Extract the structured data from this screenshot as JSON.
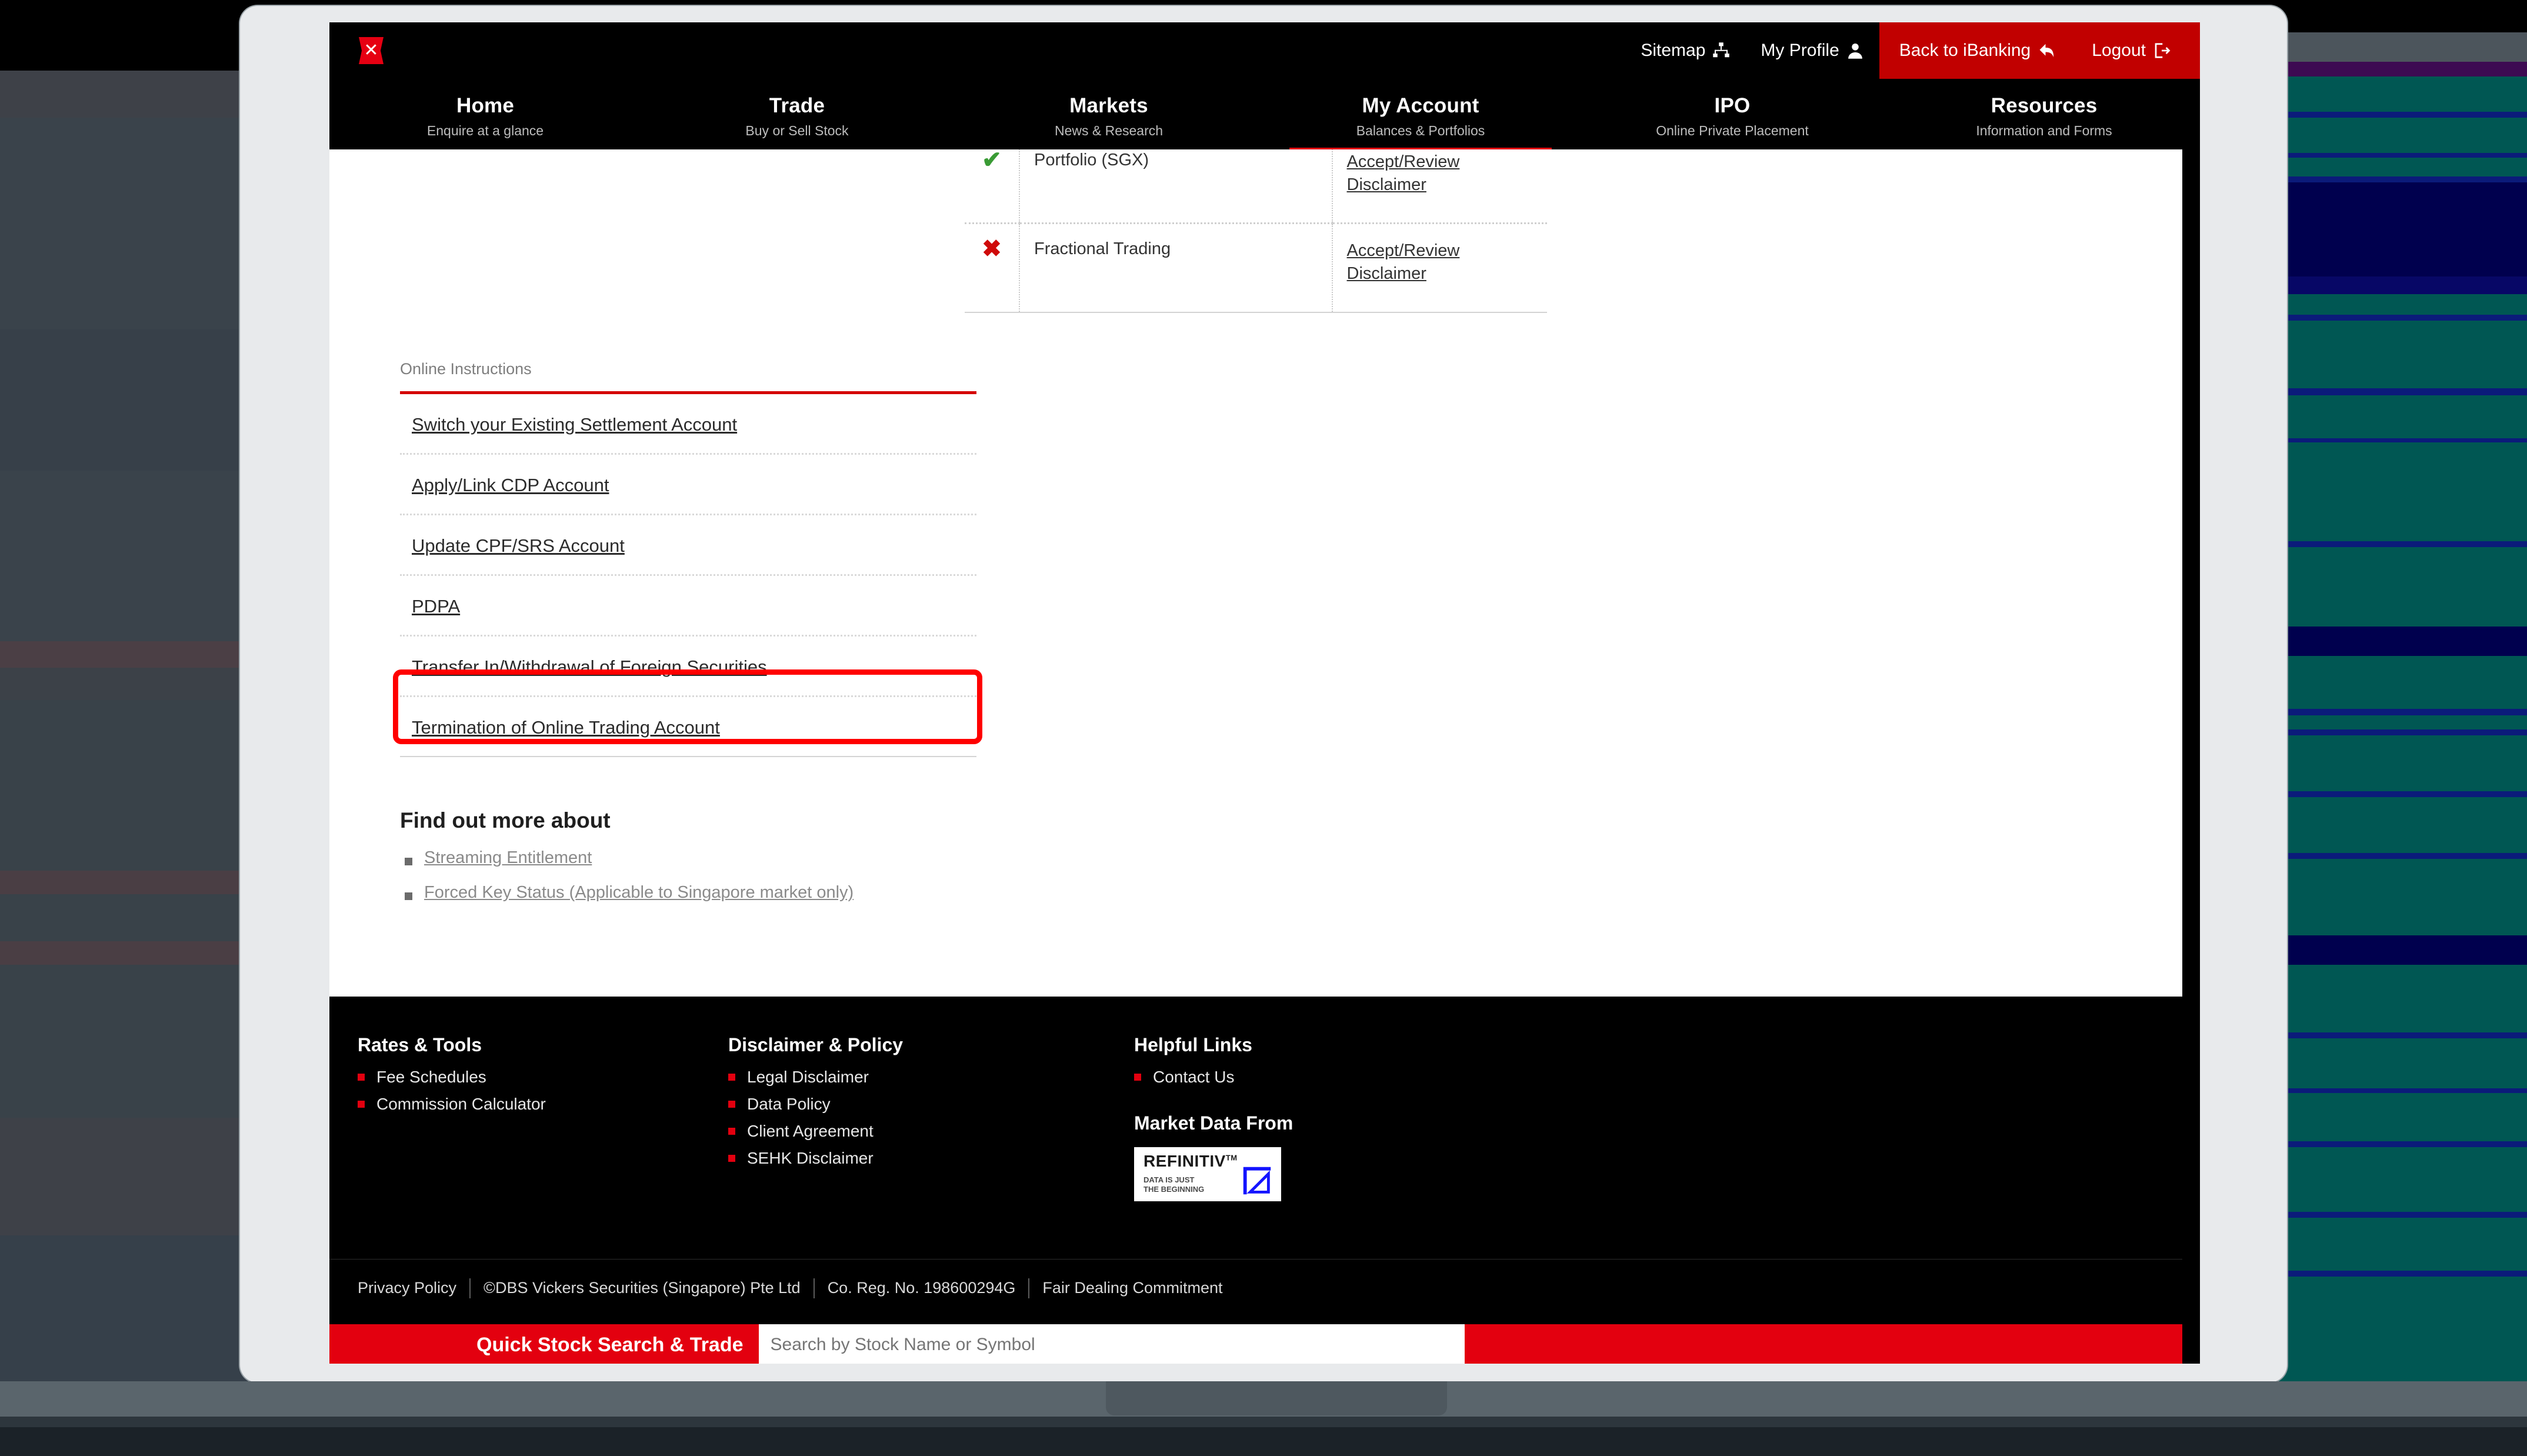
{
  "utility_bar": {
    "logo_icon": "dbs-x-logo",
    "items": [
      {
        "label": "Sitemap",
        "icon": "sitemap-icon",
        "style": "dark"
      },
      {
        "label": "My Profile",
        "icon": "user-icon",
        "style": "dark"
      },
      {
        "label": "Back to iBanking",
        "icon": "back-arrow-icon",
        "style": "red"
      },
      {
        "label": "Logout",
        "icon": "logout-icon",
        "style": "red"
      }
    ]
  },
  "main_nav": {
    "active": "My Account",
    "items": [
      {
        "title": "Home",
        "subtitle": "Enquire at a glance"
      },
      {
        "title": "Trade",
        "subtitle": "Buy or Sell Stock"
      },
      {
        "title": "Markets",
        "subtitle": "News & Research"
      },
      {
        "title": "My Account",
        "subtitle": "Balances & Portfolios"
      },
      {
        "title": "IPO",
        "subtitle": "Online Private Placement"
      },
      {
        "title": "Resources",
        "subtitle": "Information and Forms"
      }
    ]
  },
  "services_table": {
    "rows": [
      {
        "status_icon": "green-check-icon",
        "status": "enabled",
        "name": "Portfolio (SGX)",
        "action_line1": "Accept/Review",
        "action_line2": "Disclaimer"
      },
      {
        "status_icon": "red-cross-icon",
        "status": "disabled",
        "name": "Fractional Trading",
        "action_line1": "Accept/Review",
        "action_line2": "Disclaimer"
      }
    ]
  },
  "online_instructions": {
    "heading": "Online Instructions",
    "links": [
      "Switch your Existing Settlement Account",
      "Apply/Link CDP Account",
      "Update CPF/SRS Account",
      "PDPA",
      "Transfer In/Withdrawal of Foreign Securities",
      "Termination of Online Trading Account"
    ],
    "highlighted_index": 2,
    "highlight_color": "#ff0000"
  },
  "find_out_more": {
    "title": "Find out more about",
    "links": [
      "Streaming Entitlement",
      "Forced Key Status (Applicable to Singapore market only)"
    ]
  },
  "footer": {
    "columns": [
      {
        "title": "Rates & Tools",
        "links": [
          "Fee Schedules",
          "Commission Calculator"
        ]
      },
      {
        "title": "Disclaimer & Policy",
        "links": [
          "Legal Disclaimer",
          "Data Policy",
          "Client Agreement",
          "SEHK Disclaimer"
        ]
      },
      {
        "title": "Helpful Links",
        "links": [
          "Contact Us"
        ],
        "sub_title": "Market Data From",
        "logo": {
          "name": "REFINITIV",
          "trademark": "TM",
          "tagline_line1": "DATA IS JUST",
          "tagline_line2": "THE BEGINNING",
          "mark_color": "#1414ff"
        }
      }
    ],
    "copyright_bar": [
      "Privacy Policy",
      "©DBS Vickers Securities (Singapore) Pte Ltd",
      "Co. Reg. No. 198600294G",
      "Fair Dealing Commitment"
    ]
  },
  "quick_search": {
    "label": "Quick Stock Search & Trade",
    "placeholder": "Search by Stock Name or Symbol",
    "value": ""
  },
  "colors": {
    "brand_red": "#e3000f",
    "dark_red": "#c10000",
    "nav_black": "#000000",
    "highlight_red": "#ff0000",
    "status_ok": "#3a9b35",
    "status_no": "#cf0a0a"
  }
}
